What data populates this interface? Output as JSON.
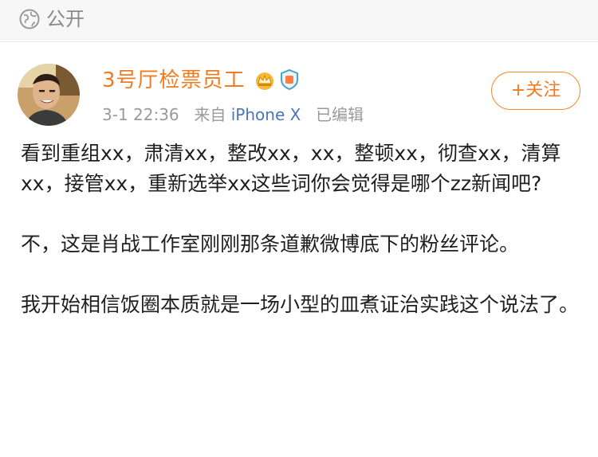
{
  "visibility": {
    "icon": "globe-icon",
    "label": "公开"
  },
  "author": {
    "name": "3号厅检票员工",
    "avatar": "avatar",
    "badges": [
      "crown-icon",
      "verified-badge-icon"
    ]
  },
  "post_meta": {
    "time": "3-1 22:36",
    "source_prefix": "来自",
    "device": "iPhone X",
    "edited": "已编辑"
  },
  "follow_button": {
    "label": "+关注"
  },
  "post": {
    "paragraphs": [
      "看到重组xx，肃清xx，整改xx，xx，整顿xx，彻查xx，清算xx，接管xx，重新选举xx这些词你会觉得是哪个zz新闻吧?",
      "不，这是肖战工作室刚刚那条道歉微博底下的粉丝评论。",
      "我开始相信饭圈本质就是一场小型的皿煮证治实践这个说法了。"
    ]
  },
  "colors": {
    "username": "#f07b20",
    "device_link": "#4a76b8",
    "meta_gray": "#9a9a9a",
    "follow_border": "#f08a2a"
  }
}
